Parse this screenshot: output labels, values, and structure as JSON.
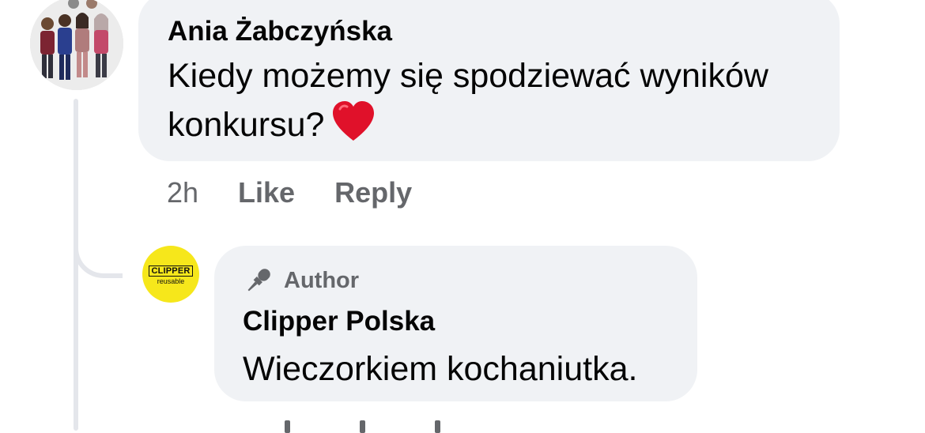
{
  "comment": {
    "author": "Ania Żabczyńska",
    "text": "Kiedy możemy się spodziewać wyników konkursu?",
    "emoji_icon": "red-heart-emoji",
    "time": "2h",
    "like_label": "Like",
    "reply_label": "Reply",
    "avatar_icon": "group-avatar-icon"
  },
  "reply": {
    "badge_icon": "microphone-icon",
    "badge_label": "Author",
    "author": "Clipper Polska",
    "text": "Wieczorkiem kochaniutka.",
    "avatar": {
      "logo_text": "CLIPPER",
      "logo_subtext": "reusable",
      "background_color": "#f6e71b"
    }
  },
  "colors": {
    "bubble": "#f0f2f5",
    "secondary_text": "#65676b",
    "primary_text": "#050505",
    "thread_line": "#e4e6eb",
    "heart": "#e0112a"
  }
}
